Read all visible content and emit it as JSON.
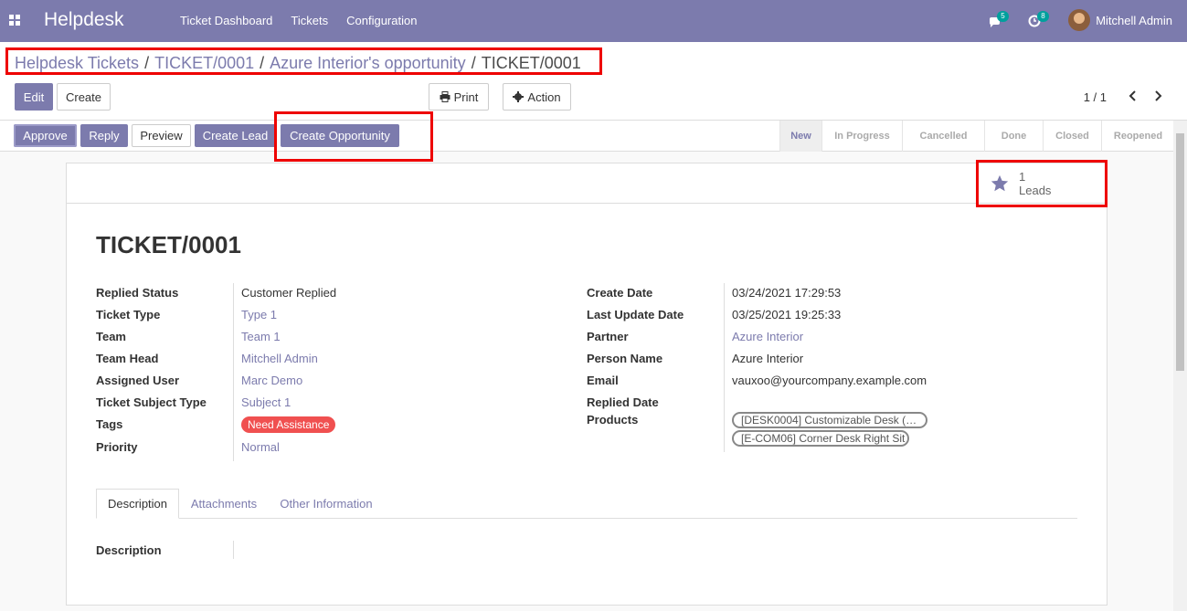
{
  "navbar": {
    "brand": "Helpdesk",
    "menu": [
      "Ticket Dashboard",
      "Tickets",
      "Configuration"
    ],
    "messages_badge": "5",
    "activities_badge": "8",
    "user": "Mitchell Admin"
  },
  "breadcrumb": {
    "items": [
      "Helpdesk Tickets",
      "TICKET/0001",
      "Azure Interior's opportunity",
      "TICKET/0001"
    ],
    "separator": "/"
  },
  "toolbar": {
    "edit": "Edit",
    "create": "Create",
    "print": "Print",
    "action": "Action",
    "pager": "1 / 1"
  },
  "statusbar": {
    "buttons": [
      "Approve",
      "Reply",
      "Preview",
      "Create Lead",
      "Create Opportunity"
    ],
    "stages": [
      "New",
      "In Progress",
      "Cancelled",
      "Done",
      "Closed",
      "Reopened"
    ],
    "current_stage": "New"
  },
  "smart_button": {
    "count": "1",
    "label": "Leads"
  },
  "record": {
    "title": "TICKET/0001",
    "left_fields": [
      {
        "label": "Replied Status",
        "value": "Customer Replied"
      },
      {
        "label": "Ticket Type",
        "value": "Type 1"
      },
      {
        "label": "Team",
        "value": "Team 1"
      },
      {
        "label": "Team Head",
        "value": "Mitchell Admin"
      },
      {
        "label": "Assigned User",
        "value": "Marc Demo"
      },
      {
        "label": "Ticket Subject Type",
        "value": "Subject 1"
      },
      {
        "label": "Tags",
        "value": "Need Assistance"
      },
      {
        "label": "Priority",
        "value": "Normal"
      }
    ],
    "right_fields": [
      {
        "label": "Create Date",
        "value": "03/24/2021 17:29:53"
      },
      {
        "label": "Last Update Date",
        "value": "03/25/2021 19:25:33"
      },
      {
        "label": "Partner",
        "value": "Azure Interior"
      },
      {
        "label": "Person Name",
        "value": "Azure Interior"
      },
      {
        "label": "Email",
        "value": "vauxoo@yourcompany.example.com"
      },
      {
        "label": "Replied Date",
        "value": ""
      },
      {
        "label": "Products",
        "values": [
          "[DESK0004] Customizable Desk (…",
          "[E-COM06] Corner Desk Right Sit"
        ]
      }
    ]
  },
  "tabs": [
    "Description",
    "Attachments",
    "Other Information"
  ],
  "description": {
    "label": "Description"
  },
  "colors": {
    "brand": "#7c7bad",
    "tag": "#f05050",
    "highlight": "#e00000"
  }
}
